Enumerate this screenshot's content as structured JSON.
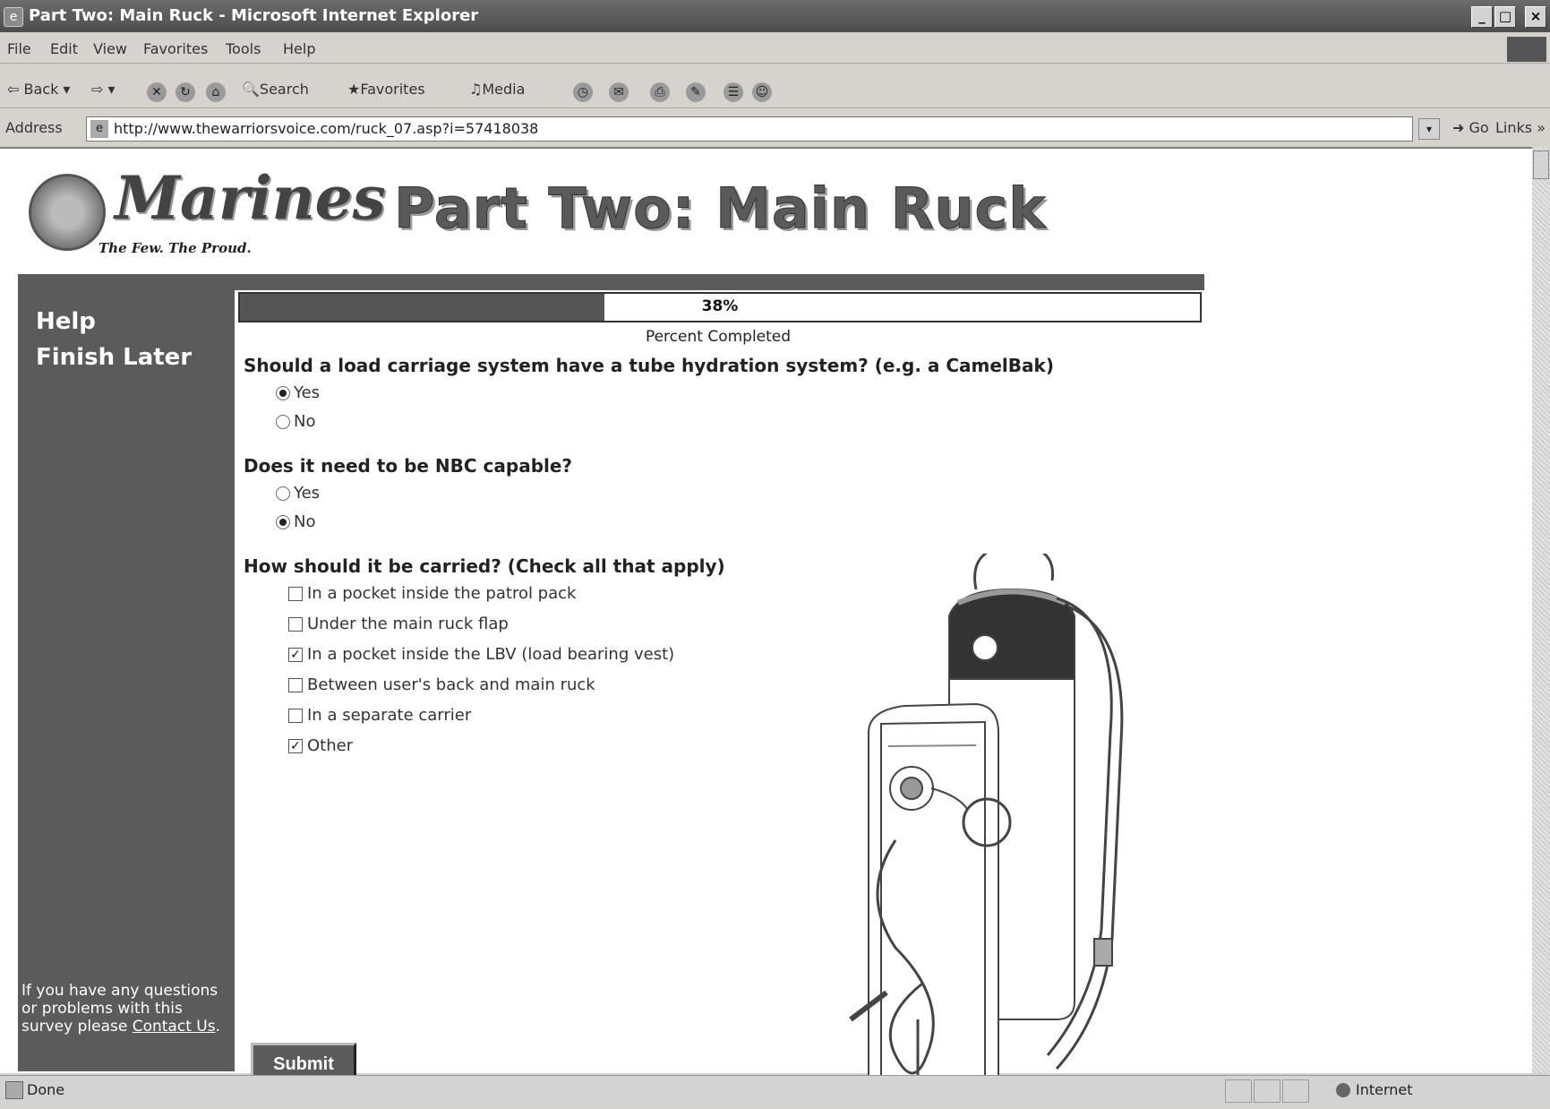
{
  "window": {
    "title": "Part Two: Main Ruck - Microsoft Internet Explorer",
    "controls": {
      "minimize": "_",
      "maximize": "□",
      "close": "×"
    }
  },
  "menu": [
    "File",
    "Edit",
    "View",
    "Favorites",
    "Tools",
    "Help"
  ],
  "toolbar": {
    "back": "Back",
    "search": "Search",
    "favorites": "Favorites",
    "media": "Media"
  },
  "address": {
    "label": "Address",
    "url": "http://www.thewarriorsvoice.com/ruck_07.asp?i=57418038",
    "go": "Go",
    "links": "Links »"
  },
  "header": {
    "brand": "Marines",
    "tagline": "The Few. The Proud.",
    "title": "Part Two: Main Ruck"
  },
  "sidebar": {
    "help": "Help",
    "finish_later": "Finish Later",
    "help_text": "If you have any questions or problems with this survey please",
    "contact_link": "Contact Us",
    "contact_suffix": "."
  },
  "progress": {
    "value": 38,
    "label": "38%",
    "caption": "Percent Completed"
  },
  "questions": [
    {
      "text": "Should a load carriage system have a tube hydration system? (e.g. a CamelBak)",
      "type": "radio",
      "options": [
        {
          "label": "Yes",
          "selected": true
        },
        {
          "label": "No",
          "selected": false
        }
      ]
    },
    {
      "text": "Does it need to be NBC capable?",
      "type": "radio",
      "options": [
        {
          "label": "Yes",
          "selected": false
        },
        {
          "label": "No",
          "selected": true
        }
      ]
    },
    {
      "text": "How should it be carried? (Check all that apply)",
      "type": "checkbox",
      "options": [
        {
          "label": "In a pocket inside the patrol pack",
          "checked": false
        },
        {
          "label": "Under the main ruck flap",
          "checked": false
        },
        {
          "label": "In a pocket inside the LBV (load bearing vest)",
          "checked": true
        },
        {
          "label": "Between user's back and main ruck",
          "checked": false
        },
        {
          "label": "In a separate carrier",
          "checked": false
        },
        {
          "label": "Other",
          "checked": true
        }
      ]
    }
  ],
  "submit": "Submit",
  "status": {
    "text": "Done",
    "zone": "Internet"
  }
}
